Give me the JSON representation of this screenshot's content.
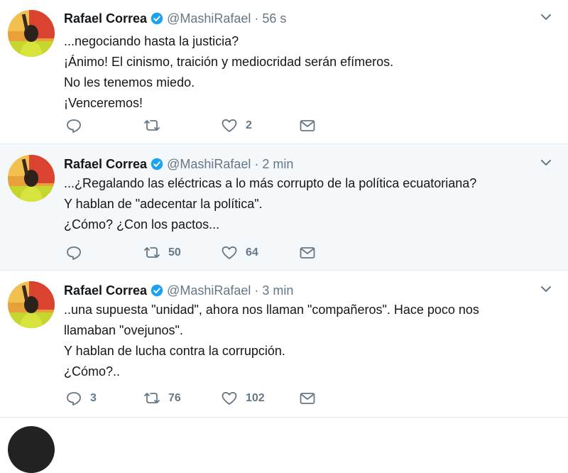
{
  "colors": {
    "verified_blue": "#1da1f2",
    "secondary_text": "#657786",
    "primary_text": "#14171a",
    "highlight_bg": "#f5f8fa"
  },
  "tweets": [
    {
      "name": "Rafael Correa",
      "handle": "@MashiRafael",
      "time": "56 s",
      "lines": [
        "...negociando hasta la justicia?",
        "¡Ánimo! El cinismo, traición y mediocridad serán efímeros.",
        "No les tenemos miedo.",
        "¡Venceremos!"
      ],
      "replies": "",
      "retweets": "",
      "likes": "2"
    },
    {
      "name": "Rafael Correa",
      "handle": "@MashiRafael",
      "time": "2 min",
      "lines": [
        "...¿Regalando las eléctricas a lo más corrupto de la política ecuatoriana?",
        "Y hablan de \"adecentar la política\".",
        "¿Cómo? ¿Con los pactos..."
      ],
      "replies": "",
      "retweets": "50",
      "likes": "64"
    },
    {
      "name": "Rafael Correa",
      "handle": "@MashiRafael",
      "time": "3 min",
      "lines": [
        "..una supuesta \"unidad\", ahora nos llaman \"compañeros\". Hace poco nos",
        "llamaban \"ovejunos\".",
        "Y hablan de lucha contra la corrupción.",
        "¿Cómo?.."
      ],
      "replies": "3",
      "retweets": "76",
      "likes": "102"
    }
  ],
  "icons": {
    "verified": "verified-badge-icon",
    "more": "chevron-down-icon",
    "reply": "reply-icon",
    "retweet": "retweet-icon",
    "like": "heart-icon",
    "dm": "envelope-icon"
  }
}
